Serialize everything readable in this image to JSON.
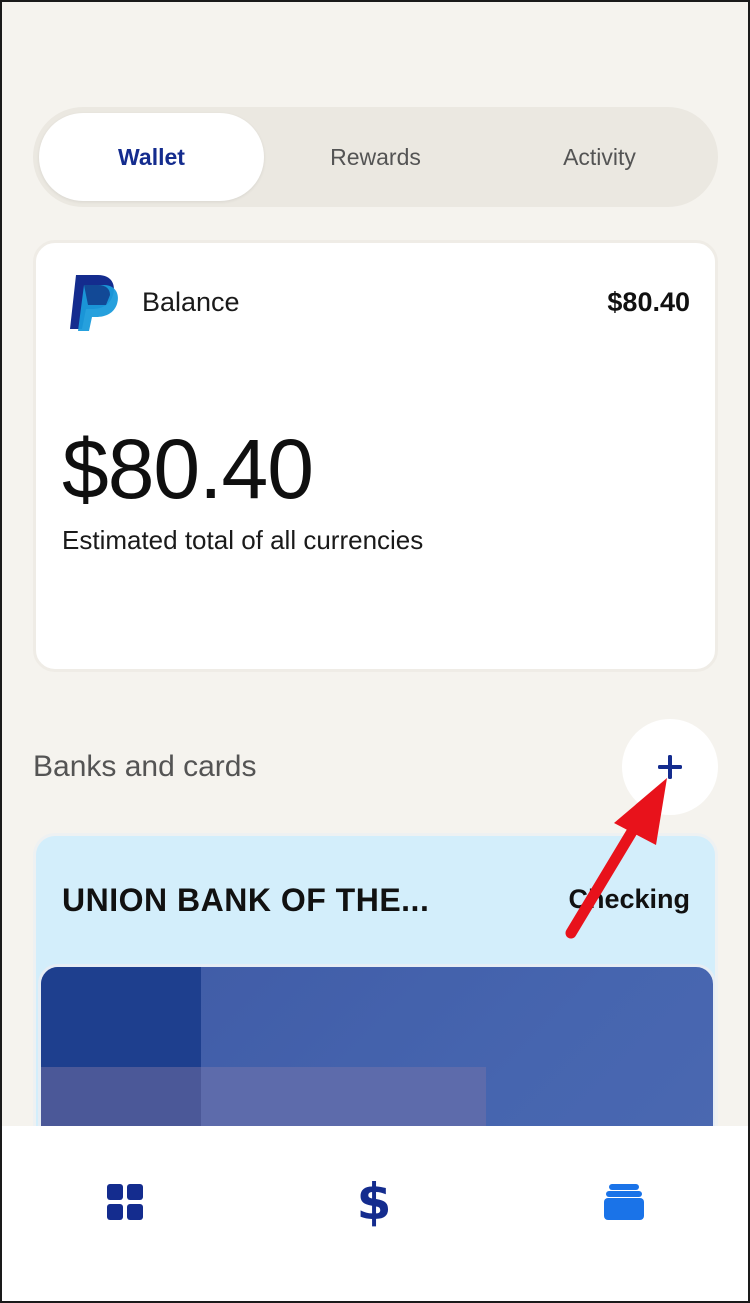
{
  "tabs": [
    {
      "label": "Wallet",
      "active": true
    },
    {
      "label": "Rewards",
      "active": false
    },
    {
      "label": "Activity",
      "active": false
    }
  ],
  "balance_card": {
    "logo": "paypal-logo",
    "label": "Balance",
    "amount_small": "$80.40",
    "amount_large": "$80.40",
    "subtitle": "Estimated total of all currencies"
  },
  "banks_section": {
    "title": "Banks and cards",
    "add_icon": "plus-icon"
  },
  "bank_card": {
    "name": "UNION BANK OF THE...",
    "type": "Checking"
  },
  "bottom_nav": [
    {
      "icon": "dashboard-grid-icon"
    },
    {
      "icon": "dollar-icon",
      "glyph": "$"
    },
    {
      "icon": "wallet-cards-icon"
    }
  ],
  "colors": {
    "background": "#f5f3ee",
    "brand_navy": "#142c8e",
    "brand_blue": "#1a73e8",
    "bank_card_bg": "#d3eefb",
    "annotation_arrow": "#e8121b"
  }
}
